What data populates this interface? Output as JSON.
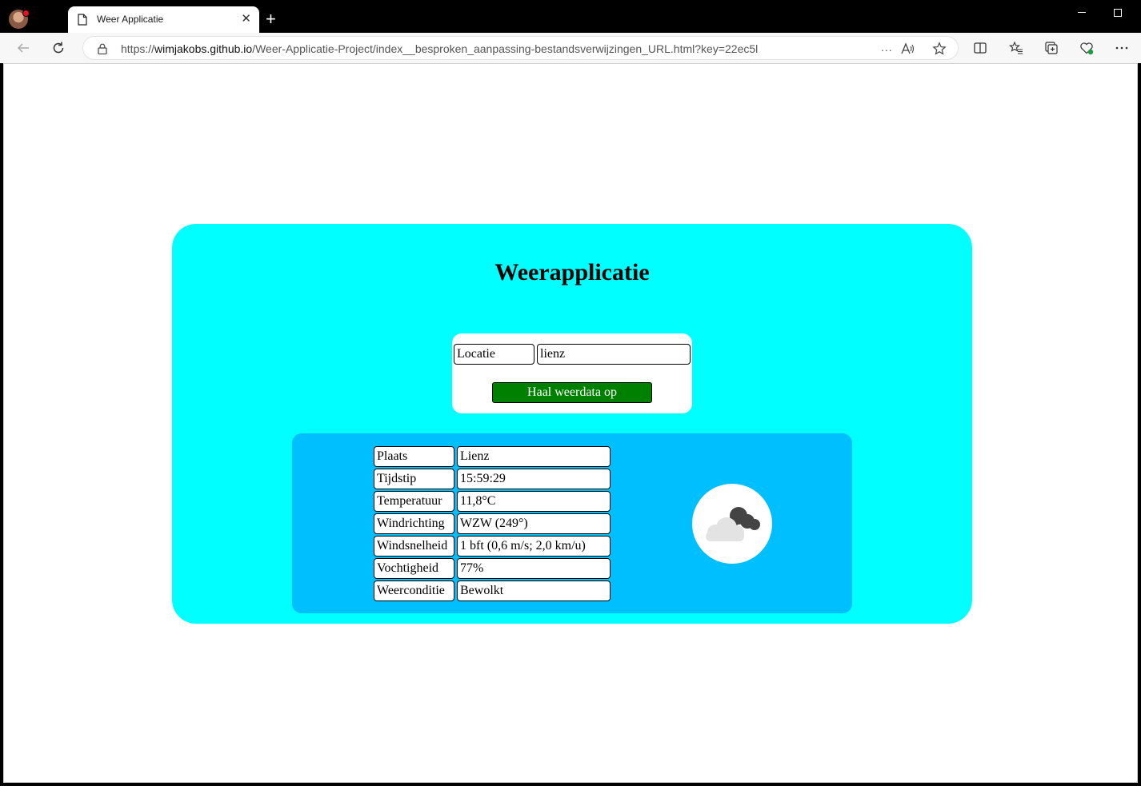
{
  "browser": {
    "tab_title": "Weer Applicatie",
    "tab_close": "✕",
    "new_tab": "+",
    "url_prefix": "https://",
    "url_host": "wimjakobs.github.io",
    "url_path": "/Weer-Applicatie-Project/index__besproken_aanpassing-bestandsverwijzingen_URL.html?key=22ec5l",
    "url_more": "..."
  },
  "app": {
    "title": "Weerapplicatie",
    "location_label": "Locatie",
    "location_value": "lienz",
    "fetch_button": "Haal weerdata op",
    "rows": [
      {
        "label": "Plaats",
        "value": "Lienz"
      },
      {
        "label": "Tijdstip",
        "value": "15:59:29"
      },
      {
        "label": "Temperatuur",
        "value": "11,8°C"
      },
      {
        "label": "Windrichting",
        "value": "WZW (249°)"
      },
      {
        "label": "Windsnelheid",
        "value": "1 bft (0,6 m/s; 2,0 km/u)"
      },
      {
        "label": "Vochtigheid",
        "value": "77%"
      },
      {
        "label": "Weerconditie",
        "value": "Bewolkt"
      }
    ],
    "weather_icon": "broken-clouds-icon"
  },
  "colors": {
    "app_bg": "#00ffff",
    "result_bg": "#00bfff",
    "button_bg": "#008000"
  }
}
